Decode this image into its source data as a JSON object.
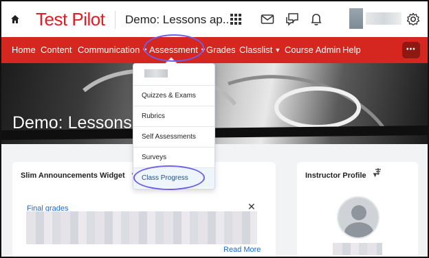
{
  "header": {
    "logo_text": "Test Pilot",
    "course_title": "Demo: Lessons ap...",
    "icons": [
      "home-icon",
      "waffle-icon",
      "mail-icon",
      "chat-icon",
      "bell-icon",
      "gear-icon"
    ]
  },
  "nav": {
    "items": [
      {
        "label": "Home",
        "has_menu": false
      },
      {
        "label": "Content",
        "has_menu": false
      },
      {
        "label": "Communication",
        "has_menu": true
      },
      {
        "label": "Assessment",
        "has_menu": true
      },
      {
        "label": "Grades",
        "has_menu": false
      },
      {
        "label": "Classlist",
        "has_menu": true
      },
      {
        "label": "Course Admin",
        "has_menu": false
      },
      {
        "label": "Help",
        "has_menu": false
      }
    ],
    "more_label": "⋯",
    "chevron": "⌄",
    "accent_color": "#d5271f"
  },
  "banner": {
    "title": "Demo: Lessons a"
  },
  "dropdown": {
    "items": [
      "Quizzes & Exams",
      "Rubrics",
      "Self Assessments",
      "Surveys",
      "Class Progress"
    ],
    "highlighted_index": 4
  },
  "widgets": {
    "announcements": {
      "title": "Slim Announcements Widget",
      "item_title": "Final grades",
      "close_label": "✕",
      "read_more": "Read More"
    },
    "profile": {
      "title": "Instructor Profile"
    }
  },
  "highlight_color": "#6f5ee8"
}
